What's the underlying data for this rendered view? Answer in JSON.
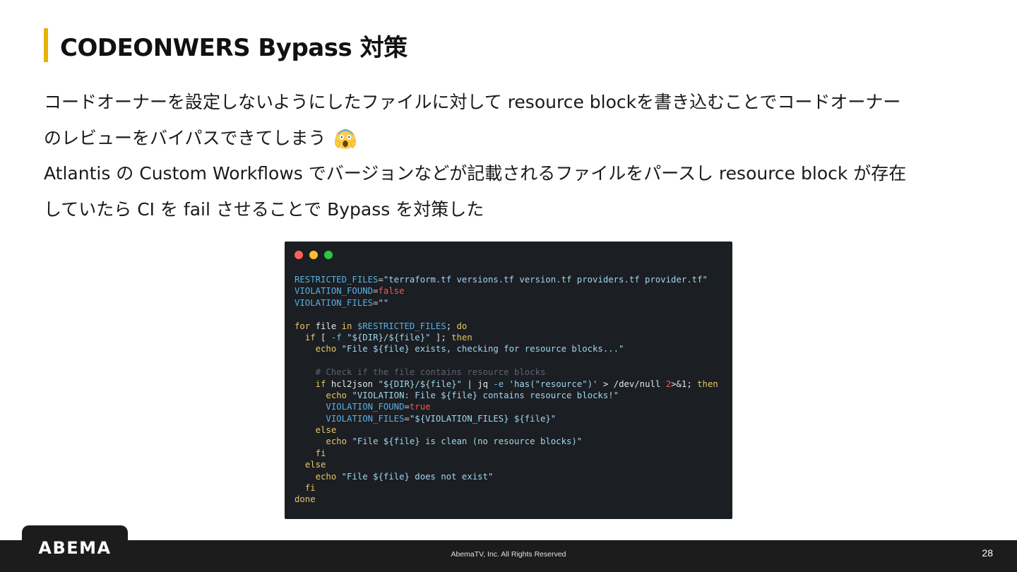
{
  "slide": {
    "title": "CODEONWERS Bypass 対策",
    "body": [
      "コードオーナーを設定しないようにしたファイルに対して resource blockを書き込むことでコードオーナー",
      "のレビューをバイパスできてしまう",
      "Atlantis の Custom Workflows でバージョンなどが記載されるファイルをパースし resource block が存在",
      "していたら CI を fail させることで Bypass を対策した"
    ],
    "emoji_icon": "screaming-face-emoji"
  },
  "code": {
    "lines": [
      [
        [
          "var",
          "RESTRICTED_FILES"
        ],
        [
          "op",
          "="
        ],
        [
          "str",
          "\"terraform.tf versions.tf version.tf providers.tf provider.tf\""
        ]
      ],
      [
        [
          "var",
          "VIOLATION_FOUND"
        ],
        [
          "op",
          "="
        ],
        [
          "red",
          "false"
        ]
      ],
      [
        [
          "var",
          "VIOLATION_FILES"
        ],
        [
          "op",
          "="
        ],
        [
          "str",
          "\"\""
        ]
      ],
      [],
      [
        [
          "kw",
          "for"
        ],
        [
          "plain",
          " file "
        ],
        [
          "kw",
          "in"
        ],
        [
          "plain",
          " "
        ],
        [
          "var",
          "$RESTRICTED_FILES"
        ],
        [
          "plain",
          "; "
        ],
        [
          "kw",
          "do"
        ]
      ],
      [
        [
          "plain",
          "  "
        ],
        [
          "kw",
          "if"
        ],
        [
          "plain",
          " [ "
        ],
        [
          "flag",
          "-f"
        ],
        [
          "plain",
          " "
        ],
        [
          "str",
          "\"${DIR}/${file}\""
        ],
        [
          "plain",
          " ]; "
        ],
        [
          "kw",
          "then"
        ]
      ],
      [
        [
          "plain",
          "    "
        ],
        [
          "echo",
          "echo"
        ],
        [
          "plain",
          " "
        ],
        [
          "str",
          "\"File ${file} exists, checking for resource blocks...\""
        ]
      ],
      [],
      [
        [
          "plain",
          "    "
        ],
        [
          "com",
          "# Check if the file contains resource blocks"
        ]
      ],
      [
        [
          "plain",
          "    "
        ],
        [
          "kw",
          "if"
        ],
        [
          "plain",
          " hcl2json "
        ],
        [
          "str",
          "\"${DIR}/${file}\""
        ],
        [
          "plain",
          " | jq "
        ],
        [
          "flag",
          "-e"
        ],
        [
          "plain",
          " "
        ],
        [
          "str",
          "'has(\"resource\")'"
        ],
        [
          "plain",
          " > /dev/null "
        ],
        [
          "red",
          "2"
        ],
        [
          "plain",
          ">&1; "
        ],
        [
          "kw",
          "then"
        ]
      ],
      [
        [
          "plain",
          "      "
        ],
        [
          "echo",
          "echo"
        ],
        [
          "plain",
          " "
        ],
        [
          "str",
          "\"VIOLATION: File ${file} contains resource blocks!\""
        ]
      ],
      [
        [
          "plain",
          "      "
        ],
        [
          "var",
          "VIOLATION_FOUND"
        ],
        [
          "op",
          "="
        ],
        [
          "red",
          "true"
        ]
      ],
      [
        [
          "plain",
          "      "
        ],
        [
          "var",
          "VIOLATION_FILES"
        ],
        [
          "op",
          "="
        ],
        [
          "str",
          "\"${VIOLATION_FILES} ${file}\""
        ]
      ],
      [
        [
          "plain",
          "    "
        ],
        [
          "kw",
          "else"
        ]
      ],
      [
        [
          "plain",
          "      "
        ],
        [
          "echo",
          "echo"
        ],
        [
          "plain",
          " "
        ],
        [
          "str",
          "\"File ${file} is clean (no resource blocks)\""
        ]
      ],
      [
        [
          "plain",
          "    "
        ],
        [
          "kw",
          "fi"
        ]
      ],
      [
        [
          "plain",
          "  "
        ],
        [
          "kw",
          "else"
        ]
      ],
      [
        [
          "plain",
          "    "
        ],
        [
          "echo",
          "echo"
        ],
        [
          "plain",
          " "
        ],
        [
          "str",
          "\"File ${file} does not exist\""
        ]
      ],
      [
        [
          "plain",
          "  "
        ],
        [
          "kw",
          "fi"
        ]
      ],
      [
        [
          "kw",
          "done"
        ]
      ]
    ]
  },
  "footer": {
    "logo": "ABEMA",
    "copyright": "AbemaTV, Inc. All Rights Reserved",
    "page_number": "28"
  },
  "colors": {
    "accent": "#e8b100",
    "footer_bg": "#1c1c1c",
    "code_bg": "#1b1e22"
  }
}
